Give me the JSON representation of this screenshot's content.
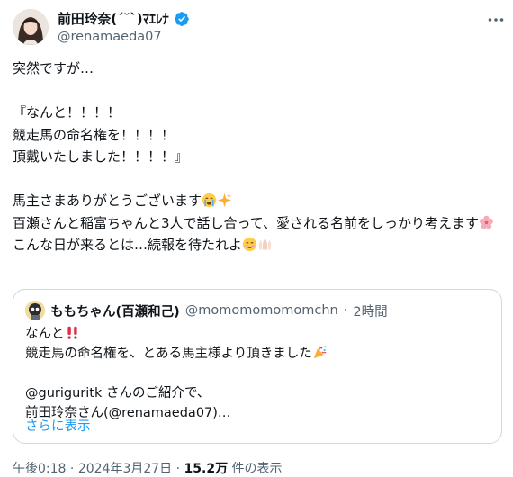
{
  "author": {
    "display_name": "前田玲奈(ˊ˘ˋ)ﾏｴﾚﾅ",
    "handle": "@renamaeda07",
    "verified": true
  },
  "tweet": {
    "line1": "突然ですが…",
    "line2": "『なんと！！！！",
    "line3": "競走馬の命名権を！！！！",
    "line4": "頂戴いたしました！！！！』",
    "line5": "馬主さまありがとうございます",
    "line6": "百瀬さんと稲富ちゃんと3人で話し合って、愛される名前をしっかり考えます",
    "line7": "こんな日が来るとは…続報を待たれよ"
  },
  "quote": {
    "display_name": "ももちゃん(百瀬和己)",
    "handle": "@momomomomomchn",
    "time": "2時間",
    "line1": "なんと",
    "line2": "競走馬の命名権を、とある馬主様より頂きました",
    "line3": "@guriguritk さんのご紹介で、",
    "line4": "前田玲奈さん(@renamaeda07)…",
    "show_more": "さらに表示"
  },
  "meta": {
    "time": "午後0:18",
    "date": "2024年3月27日",
    "views_count": "15.2万",
    "views_label": "件の表示"
  },
  "icons": {
    "verified": "verified-badge-icon",
    "more": "more-options-icon"
  },
  "colors": {
    "accent": "#1d9bf0",
    "secondary_text": "#536471",
    "border": "#cfd9de"
  }
}
